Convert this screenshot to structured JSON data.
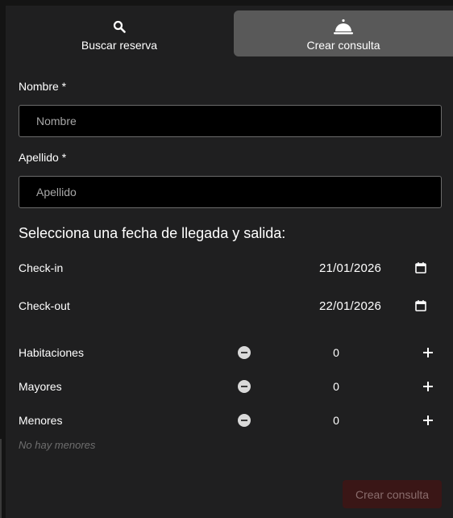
{
  "tabs": {
    "search": {
      "label": "Buscar reserva",
      "icon": "search-icon"
    },
    "create": {
      "label": "Crear consulta",
      "icon": "cloche-icon",
      "active": true
    }
  },
  "form": {
    "first_name": {
      "label": "Nombre *",
      "placeholder": "Nombre",
      "value": ""
    },
    "last_name": {
      "label": "Apellido *",
      "placeholder": "Apellido",
      "value": ""
    },
    "dates_title": "Selecciona una fecha de llegada y salida:",
    "checkin": {
      "label": "Check-in",
      "value": "21/01/2026",
      "icon": "calendar-icon"
    },
    "checkout": {
      "label": "Check-out",
      "value": "22/01/2026",
      "icon": "calendar-icon"
    },
    "counters": {
      "rooms": {
        "label": "Habitaciones",
        "value": "0"
      },
      "adults": {
        "label": "Mayores",
        "value": "0"
      },
      "children": {
        "label": "Menores",
        "value": "0"
      }
    },
    "children_hint": "No hay menores",
    "submit_label": "Crear consulta"
  },
  "colors": {
    "background": "#1f1f20",
    "active_tab": "#595959",
    "input_background": "#000000",
    "submit_disabled_bg": "#3a1616",
    "submit_disabled_text": "#8a6d6d"
  }
}
